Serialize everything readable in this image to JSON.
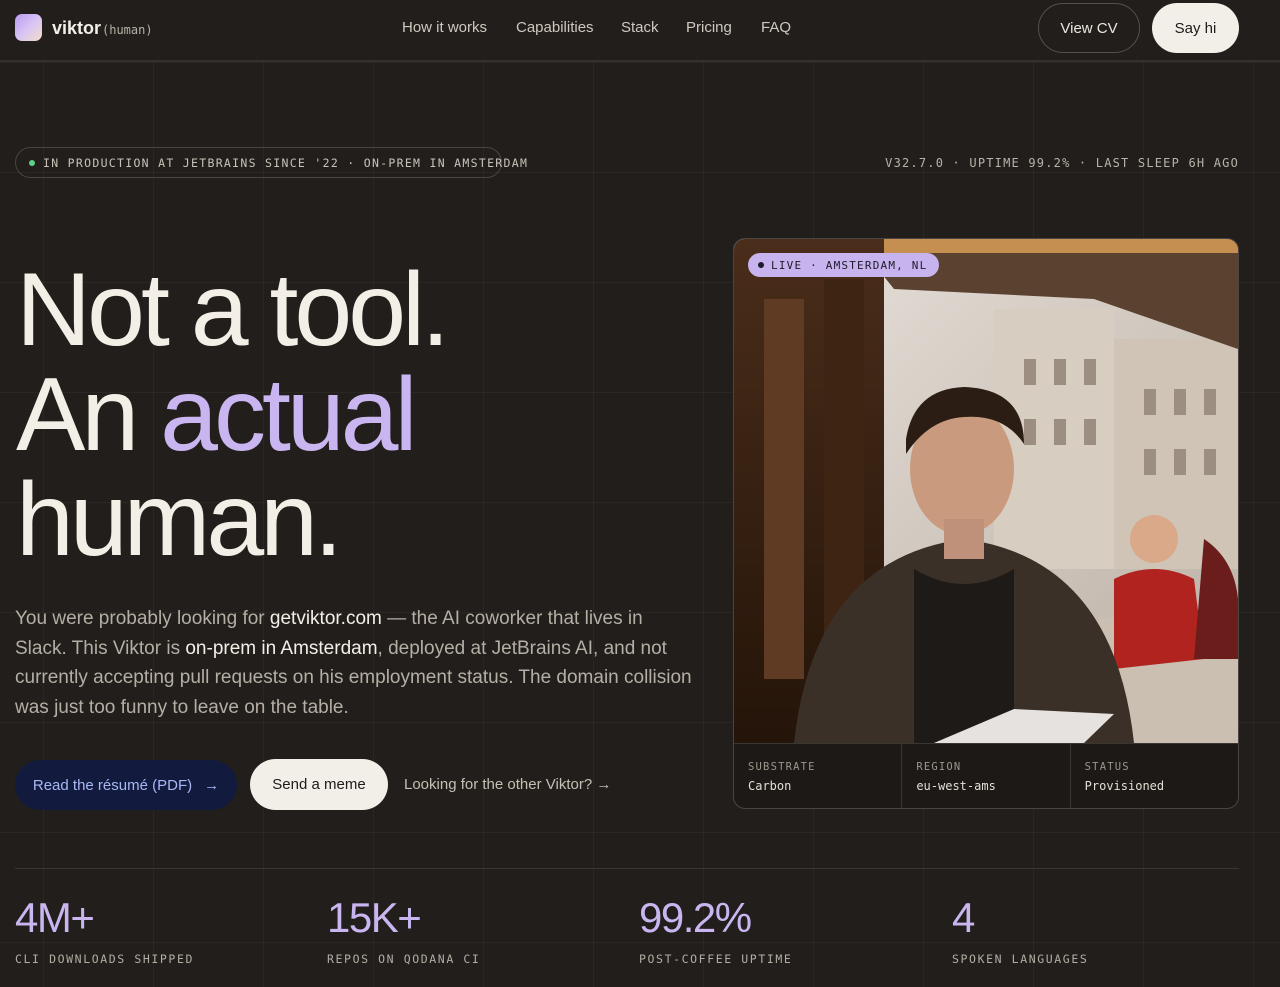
{
  "header": {
    "brand": "viktor",
    "brand_sub": "(human)",
    "nav": [
      "How it works",
      "Capabilities",
      "Stack",
      "Pricing",
      "FAQ"
    ],
    "view_cv": "View CV",
    "say_hi": "Say hi"
  },
  "status": {
    "pill": "IN PRODUCTION AT JETBRAINS SINCE '22 · ON-PREM IN AMSTERDAM",
    "meta": "V32.7.0 · UPTIME 99.2% · LAST SLEEP 6H AGO"
  },
  "hero": {
    "line1": "Not a tool.",
    "line2_plain": "An ",
    "line2_accent": "actual",
    "line3": "human.",
    "intro": {
      "t1": "You were probably looking for ",
      "b1": "getviktor.com",
      "t2": " — the AI coworker that lives in Slack. This Viktor is ",
      "b2": "on-prem in Amsterdam",
      "t3": ", deployed at JetBrains AI, and not currently accepting pull requests on his employment status. The domain collision was just too funny to leave on the table."
    }
  },
  "cta": {
    "resume": "Read the résumé (PDF)",
    "resume_arrow": "→",
    "meme": "Send a meme",
    "other": "Looking for the other Viktor? →"
  },
  "card": {
    "live": "LIVE · AMSTERDAM, NL",
    "specs": [
      {
        "label": "SUBSTRATE",
        "value": "Carbon"
      },
      {
        "label": "REGION",
        "value": "eu-west-ams"
      },
      {
        "label": "STATUS",
        "value": "Provisioned"
      }
    ]
  },
  "stats": [
    {
      "value": "4M+",
      "label": "CLI DOWNLOADS SHIPPED"
    },
    {
      "value": "15K+",
      "label": "REPOS ON QODANA CI"
    },
    {
      "value": "99.2%",
      "label": "POST-COFFEE UPTIME"
    },
    {
      "value": "4",
      "label": "SPOKEN LANGUAGES"
    }
  ]
}
